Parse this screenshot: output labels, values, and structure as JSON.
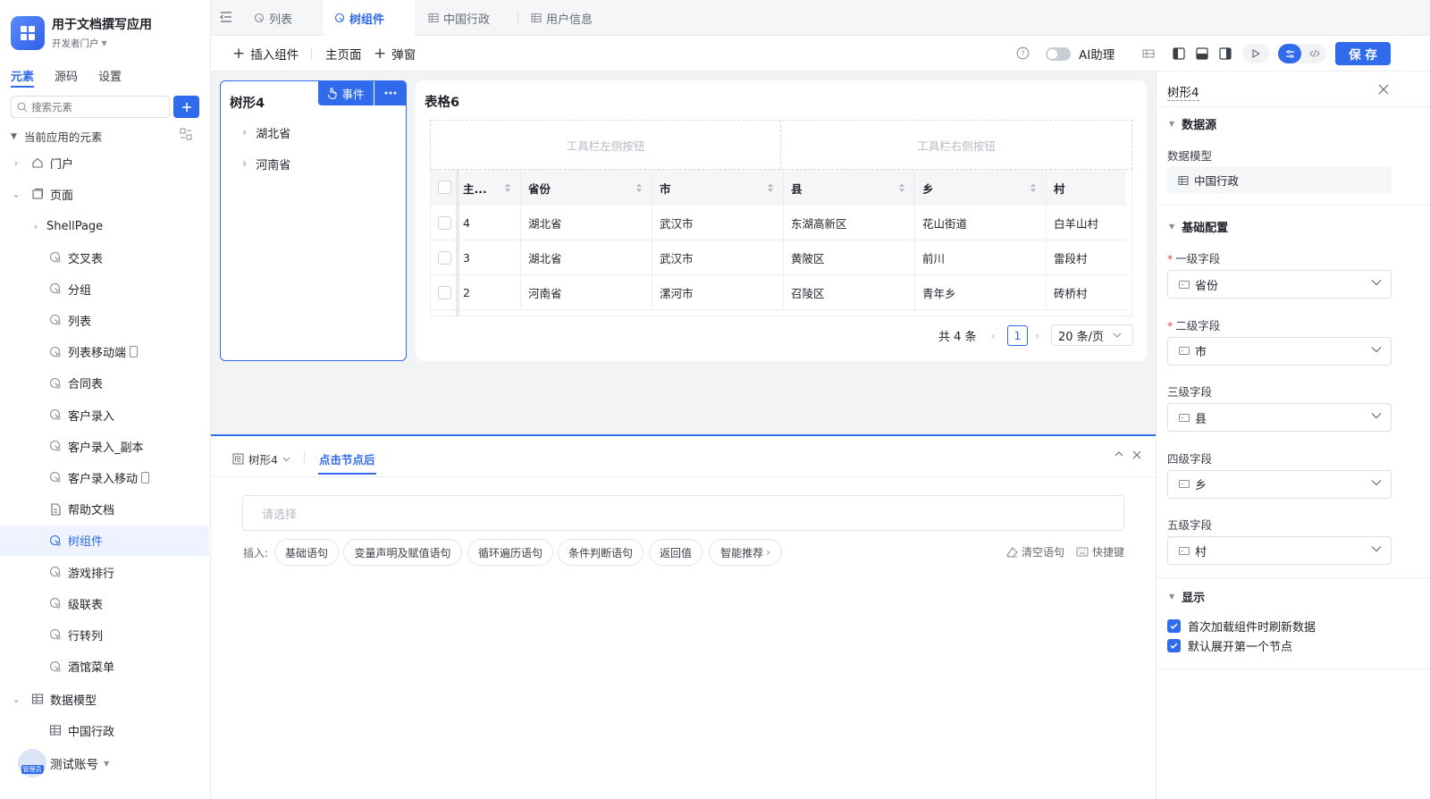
{
  "app": {
    "name": "用于文档撰写应用",
    "portal": "开发者门户"
  },
  "side_tabs": [
    "元素",
    "源码",
    "设置"
  ],
  "search": {
    "placeholder": "搜索元素"
  },
  "tree_header": "当前应用的元素",
  "tree": {
    "portal": "门户",
    "pages": "页面",
    "shell": "ShellPage",
    "items": [
      "交叉表",
      "分组",
      "列表",
      "列表移动端",
      "合同表",
      "客户录入",
      "客户录入_副本",
      "客户录入移动",
      "帮助文档",
      "树组件",
      "游戏排行",
      "级联表",
      "行转列",
      "酒馆菜单"
    ],
    "models": "数据模型",
    "model_items": [
      "中国行政"
    ]
  },
  "account": {
    "name": "测试账号",
    "badge": "管理员"
  },
  "tabs": [
    "列表",
    "树组件",
    "中国行政",
    "用户信息"
  ],
  "toolbar": {
    "insert": "插入组件",
    "main_page": "主页面",
    "popup": "弹窗",
    "ai": "AI助理",
    "save": "保 存"
  },
  "tree_card": {
    "title": "树形4",
    "event": "事件",
    "nodes": [
      "湖北省",
      "河南省"
    ]
  },
  "table_card": {
    "title": "表格6",
    "toolbar_left": "工具栏左侧按钮",
    "toolbar_right": "工具栏右侧按钮",
    "columns": [
      "主...",
      "省份",
      "市",
      "县",
      "乡",
      "村"
    ],
    "rows": [
      [
        "4",
        "湖北省",
        "武汉市",
        "东湖高新区",
        "花山街道",
        "白羊山村"
      ],
      [
        "3",
        "湖北省",
        "武汉市",
        "黄陂区",
        "前川",
        "雷段村"
      ],
      [
        "2",
        "河南省",
        "漯河市",
        "召陵区",
        "青年乡",
        "砖桥村"
      ]
    ],
    "total": "共 4 条",
    "page": "1",
    "page_size": "20 条/页"
  },
  "bottom": {
    "component": "树形4",
    "event_tab": "点击节点后",
    "select_placeholder": "请选择",
    "insert_label": "插入:",
    "chips": [
      "基础语句",
      "变量声明及赋值语句",
      "循环遍历语句",
      "条件判断语句",
      "返回值",
      "智能推荐"
    ],
    "clear": "清空语句",
    "shortcut": "快捷键"
  },
  "panel": {
    "title": "树形4",
    "datasource": "数据源",
    "model_label": "数据模型",
    "model_value": "中国行政",
    "basic": "基础配置",
    "fields": [
      {
        "label": "一级字段",
        "value": "省份",
        "required": true
      },
      {
        "label": "二级字段",
        "value": "市",
        "required": true
      },
      {
        "label": "三级字段",
        "value": "县",
        "required": false
      },
      {
        "label": "四级字段",
        "value": "乡",
        "required": false
      },
      {
        "label": "五级字段",
        "value": "村",
        "required": false
      }
    ],
    "display": "显示",
    "options": [
      "首次加载组件时刷新数据",
      "默认展开第一个节点"
    ]
  },
  "colors": {
    "accent": "#2f6bea",
    "selected_bg": "#eef3ff"
  }
}
